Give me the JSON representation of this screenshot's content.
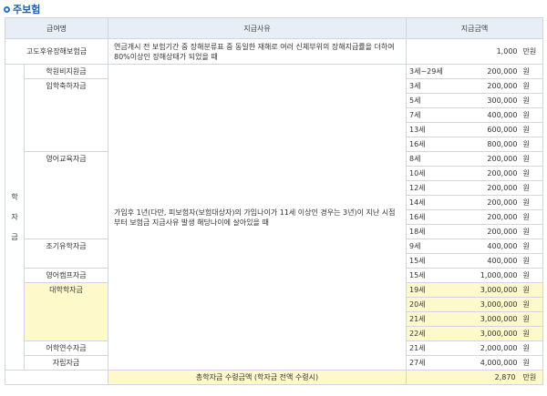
{
  "heading": "주보험",
  "columns": {
    "name": "급여명",
    "reason": "지급사유",
    "amount": "지급금액"
  },
  "top_row": {
    "name": "고도후유장해보험금",
    "reason": "연금개시 전 보험기간 중 장해분류표 중 동일한 재해로 여러 신체부위의 장해지급률을 더하여 80%이상인 장해상태가 되었을 때",
    "amount": "1,000",
    "unit": "만원"
  },
  "category_label": [
    "학",
    "자",
    "금"
  ],
  "category_reason": "가입후 1년(다만, 피보험자(보험대상자)의 가입나이가 11세 이상인 경우는 3년)이 지난 시점부터 보험금 지급사유 발생 해당나이에 살아있을 때",
  "groups": [
    {
      "name": "학원비지원금",
      "rows": [
        {
          "age": "3세~29세",
          "amount": "200,000",
          "unit": "원"
        }
      ]
    },
    {
      "name": "입학축하자금",
      "rows": [
        {
          "age": "3세",
          "amount": "200,000",
          "unit": "원"
        },
        {
          "age": "5세",
          "amount": "300,000",
          "unit": "원"
        },
        {
          "age": "7세",
          "amount": "400,000",
          "unit": "원"
        },
        {
          "age": "13세",
          "amount": "600,000",
          "unit": "원"
        },
        {
          "age": "16세",
          "amount": "800,000",
          "unit": "원"
        }
      ]
    },
    {
      "name": "영어교육자금",
      "rows": [
        {
          "age": "8세",
          "amount": "200,000",
          "unit": "원"
        },
        {
          "age": "10세",
          "amount": "200,000",
          "unit": "원"
        },
        {
          "age": "12세",
          "amount": "200,000",
          "unit": "원"
        },
        {
          "age": "14세",
          "amount": "200,000",
          "unit": "원"
        },
        {
          "age": "16세",
          "amount": "200,000",
          "unit": "원"
        },
        {
          "age": "18세",
          "amount": "200,000",
          "unit": "원"
        }
      ]
    },
    {
      "name": "조기유학자금",
      "rows": [
        {
          "age": "9세",
          "amount": "400,000",
          "unit": "원"
        },
        {
          "age": "15세",
          "amount": "400,000",
          "unit": "원"
        }
      ]
    },
    {
      "name": "영어캠프자금",
      "rows": [
        {
          "age": "15세",
          "amount": "1,000,000",
          "unit": "원"
        }
      ]
    },
    {
      "name": "대학학자금",
      "highlight": true,
      "rows": [
        {
          "age": "19세",
          "amount": "3,000,000",
          "unit": "원"
        },
        {
          "age": "20세",
          "amount": "3,000,000",
          "unit": "원"
        },
        {
          "age": "21세",
          "amount": "3,000,000",
          "unit": "원"
        },
        {
          "age": "22세",
          "amount": "3,000,000",
          "unit": "원"
        }
      ]
    },
    {
      "name": "어학연수자금",
      "rows": [
        {
          "age": "21세",
          "amount": "2,000,000",
          "unit": "원"
        }
      ]
    },
    {
      "name": "자립자금",
      "rows": [
        {
          "age": "27세",
          "amount": "4,000,000",
          "unit": "원"
        }
      ]
    }
  ],
  "total": {
    "label": "총학자금 수령금액 (학자금 전액 수령시)",
    "amount": "2,870",
    "unit": "만원"
  },
  "highlight_color": "#fdf9cb",
  "header_color": "#e7eef5",
  "heading_color": "#1f5fa8"
}
